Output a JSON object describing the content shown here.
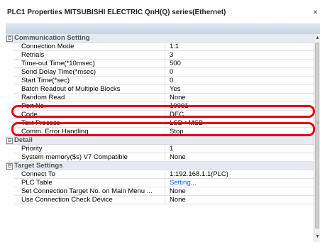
{
  "window": {
    "title": "PLC1 Properties MITSUBISHI ELECTRIC QnH(Q) series(Ethernet)",
    "close_glyph": "×"
  },
  "sections": {
    "communication": {
      "label": "Communication Setting",
      "toggle": "⊟",
      "rows": [
        {
          "name": "Connection Mode",
          "value": "1:1"
        },
        {
          "name": "Retrials",
          "value": "3"
        },
        {
          "name": "Time-out Time(*10msec)",
          "value": "500"
        },
        {
          "name": "Send Delay Time(*msec)",
          "value": "0"
        },
        {
          "name": "Start Time(*sec)",
          "value": "0"
        },
        {
          "name": "Batch Readout of Multiple Blocks",
          "value": "Yes"
        },
        {
          "name": "Random Read",
          "value": "None"
        },
        {
          "name": "Port No.",
          "value": "10001"
        },
        {
          "name": "Code",
          "value": "DEC"
        },
        {
          "name": "Text Process",
          "value": "LSB->MSB"
        },
        {
          "name": "Comm. Error Handling",
          "value": "Stop"
        }
      ]
    },
    "detail": {
      "label": "Detail",
      "toggle": "⊟",
      "rows": [
        {
          "name": "Priority",
          "value": "1"
        },
        {
          "name": "System memory($s) V7 Compatible",
          "value": "None"
        }
      ]
    },
    "target": {
      "label": "Target Settings",
      "toggle": "⊟",
      "rows": [
        {
          "name": "Connect To",
          "value": "1:192.168.1.1(PLC)"
        },
        {
          "name": "PLC Table",
          "value": "Setting..."
        },
        {
          "name": "Set Connection Target No. on Main Menu ...",
          "value": "None"
        },
        {
          "name": "Use Connection Check Device",
          "value": "None"
        }
      ]
    }
  },
  "colors": {
    "highlight": "#e30613",
    "link": "#1a5fd1",
    "category_bg": "#e7ebf1"
  },
  "icons": {
    "scroll_up": "▲",
    "scroll_down": "▼",
    "thumb_grip": "≡"
  }
}
